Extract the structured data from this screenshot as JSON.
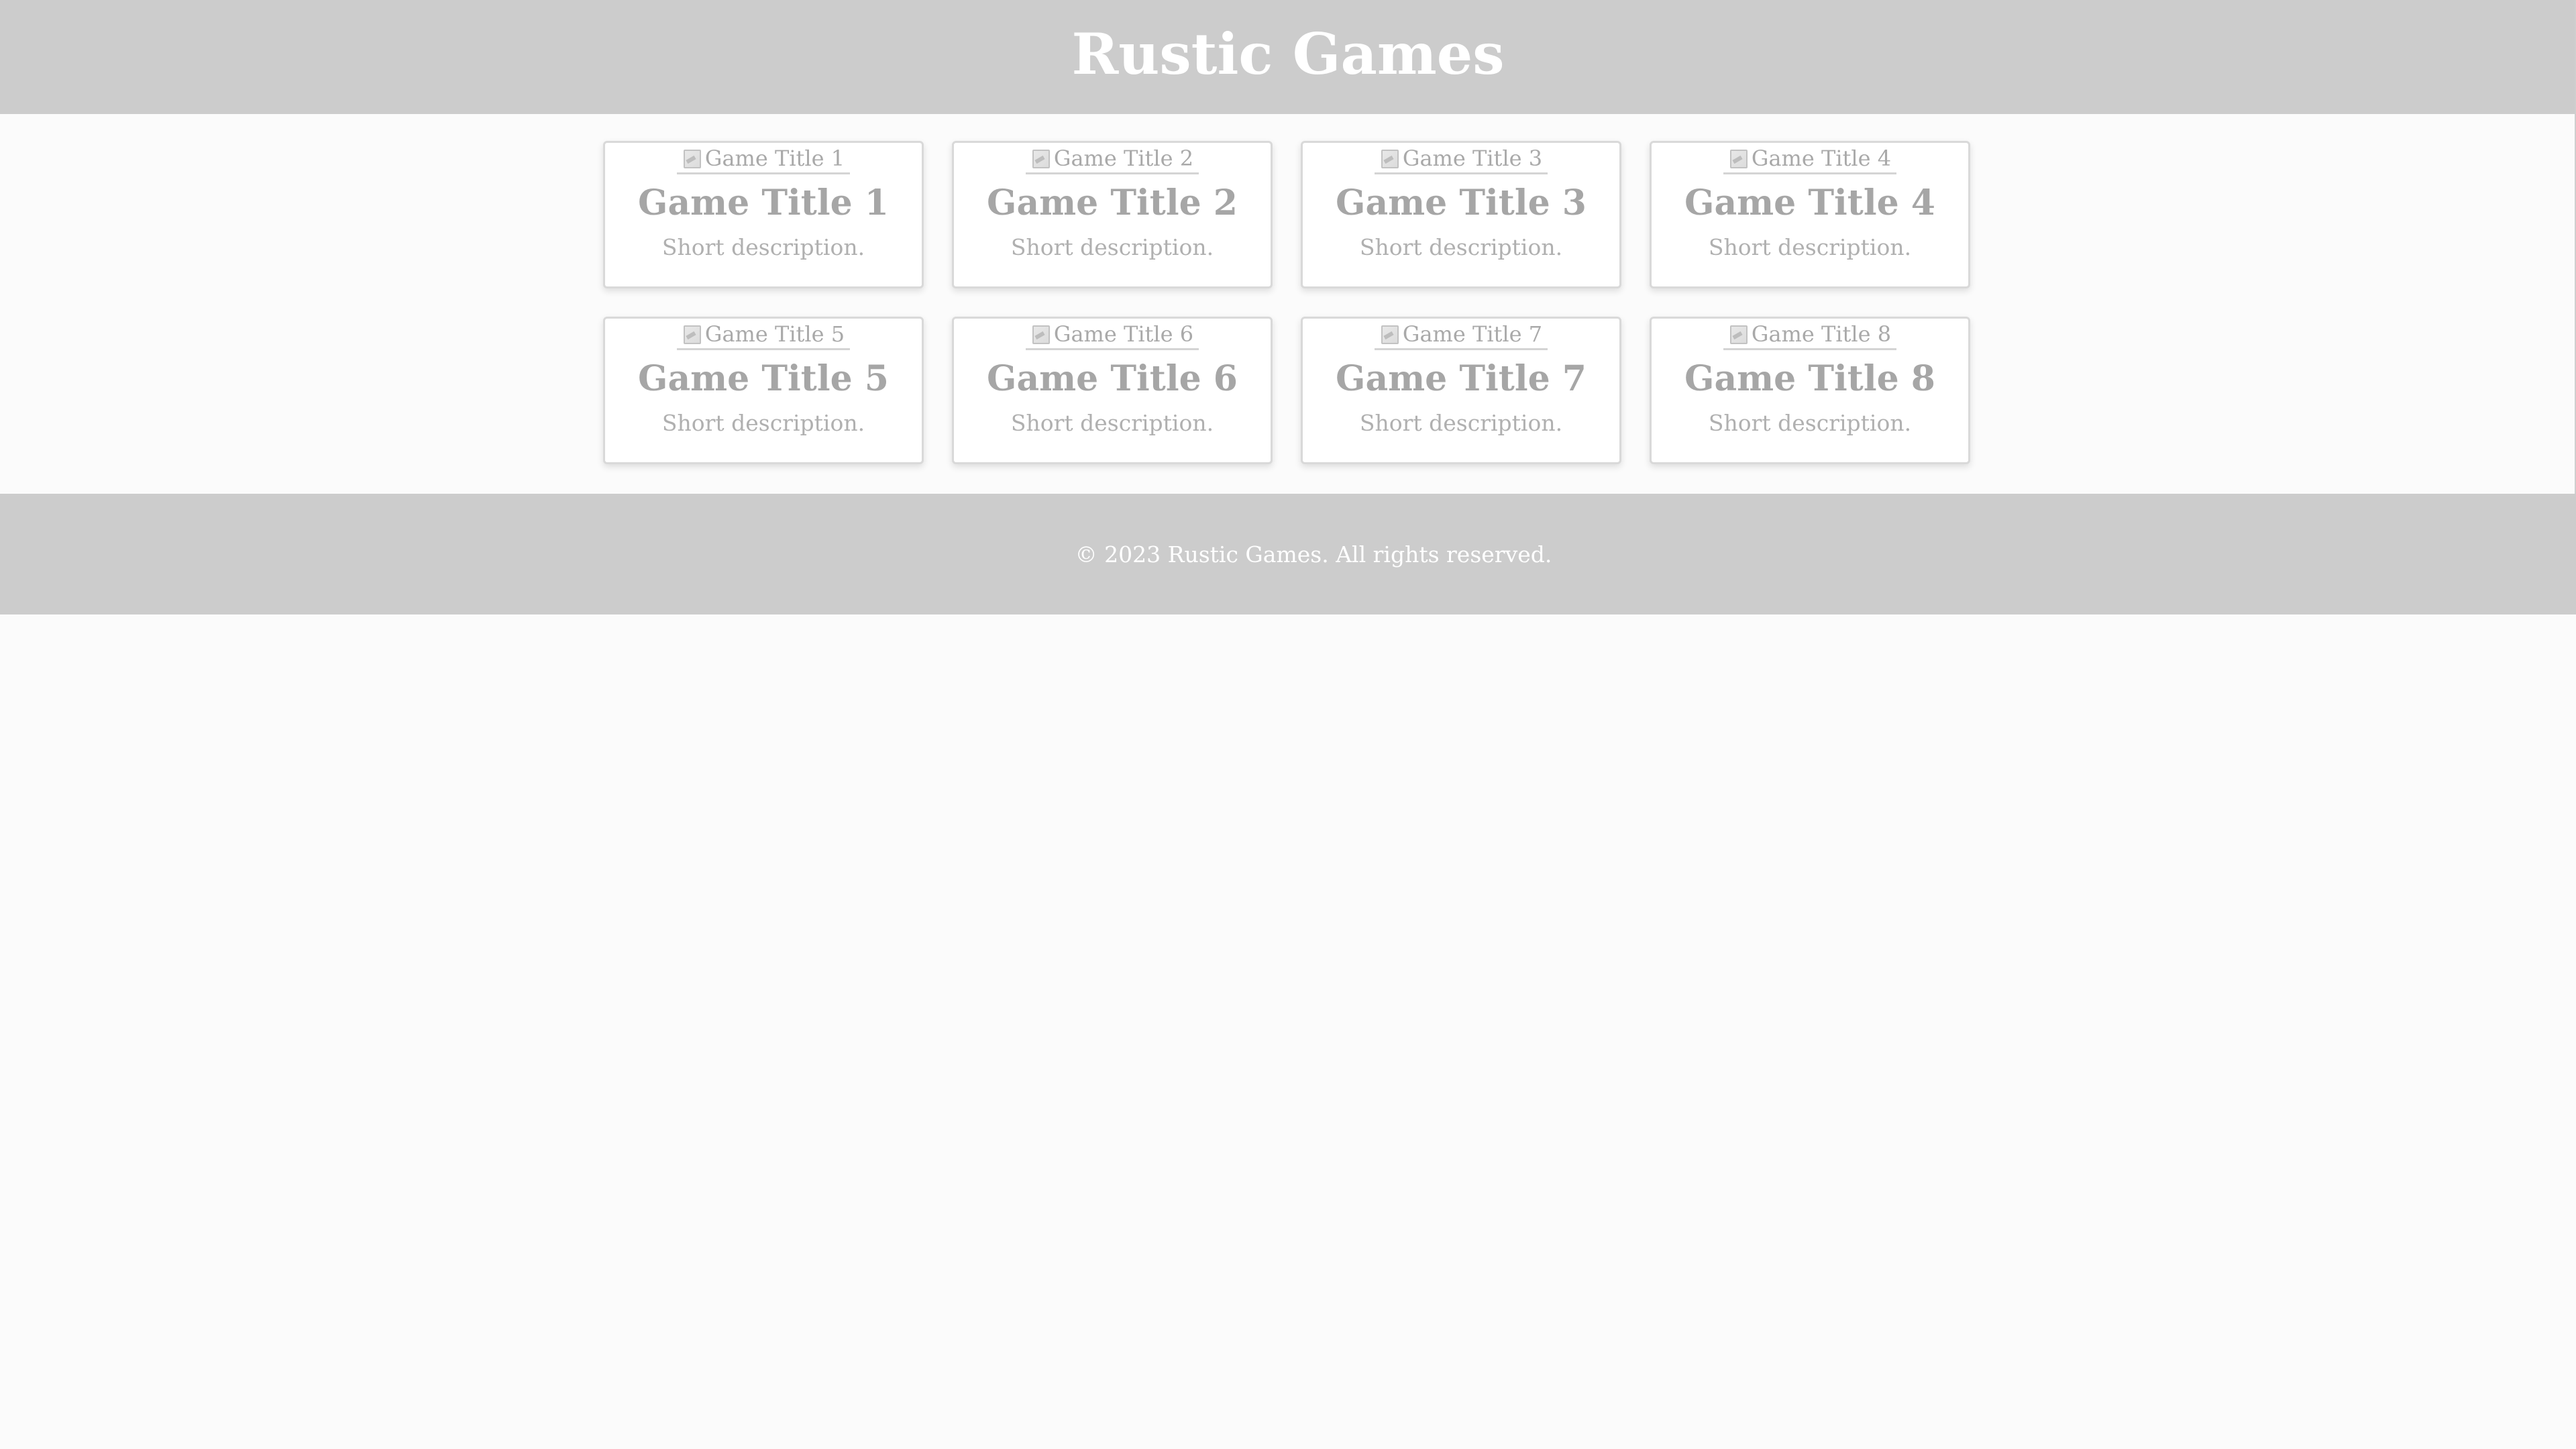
{
  "header": {
    "title": "Rustic Games"
  },
  "games": [
    {
      "image_alt": "Game Title 1",
      "title": "Game Title 1",
      "description": "Short description."
    },
    {
      "image_alt": "Game Title 2",
      "title": "Game Title 2",
      "description": "Short description."
    },
    {
      "image_alt": "Game Title 3",
      "title": "Game Title 3",
      "description": "Short description."
    },
    {
      "image_alt": "Game Title 4",
      "title": "Game Title 4",
      "description": "Short description."
    },
    {
      "image_alt": "Game Title 5",
      "title": "Game Title 5",
      "description": "Short description."
    },
    {
      "image_alt": "Game Title 6",
      "title": "Game Title 6",
      "description": "Short description."
    },
    {
      "image_alt": "Game Title 7",
      "title": "Game Title 7",
      "description": "Short description."
    },
    {
      "image_alt": "Game Title 8",
      "title": "Game Title 8",
      "description": "Short description."
    }
  ],
  "footer": {
    "text": "© 2023 Rustic Games. All rights reserved."
  },
  "colors": {
    "header_bg": "#cccccc",
    "page_bg": "#fbfbfb",
    "card_text": "#a6a6a6",
    "footer_text": "#ffffff"
  },
  "icons": {
    "broken_image": "broken-image-icon"
  }
}
